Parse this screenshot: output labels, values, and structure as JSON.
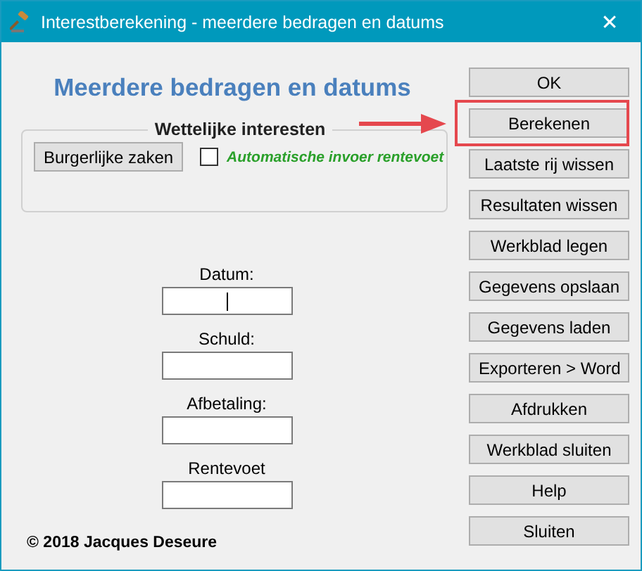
{
  "window": {
    "title": "Interestberekening - meerdere bedragen en datums",
    "close": "✕"
  },
  "heading": "Meerdere bedragen en datums",
  "group": {
    "legend": "Wettelijke interesten",
    "button": "Burgerlijke zaken",
    "checkbox": {
      "label": "Automatische invoer rentevoet",
      "checked": false
    }
  },
  "fields": [
    {
      "label": "Datum:",
      "focused": true
    },
    {
      "label": "Schuld:",
      "focused": false
    },
    {
      "label": "Afbetaling:",
      "focused": false
    },
    {
      "label": "Rentevoet",
      "focused": false
    }
  ],
  "copyright": "© 2018 Jacques Deseure",
  "buttons": [
    {
      "label": "OK",
      "highlighted": false
    },
    {
      "label": "Berekenen",
      "highlighted": true
    },
    {
      "label": "Laatste rij wissen",
      "highlighted": false
    },
    {
      "label": "Resultaten wissen",
      "highlighted": false
    },
    {
      "label": "Werkblad legen",
      "highlighted": false
    },
    {
      "label": "Gegevens opslaan",
      "highlighted": false
    },
    {
      "label": "Gegevens laden",
      "highlighted": false
    },
    {
      "label": "Exporteren > Word",
      "highlighted": false
    },
    {
      "label": "Afdrukken",
      "highlighted": false
    },
    {
      "label": "Werkblad sluiten",
      "highlighted": false
    },
    {
      "label": "Help",
      "highlighted": false
    },
    {
      "label": "Sluiten",
      "highlighted": false
    }
  ]
}
